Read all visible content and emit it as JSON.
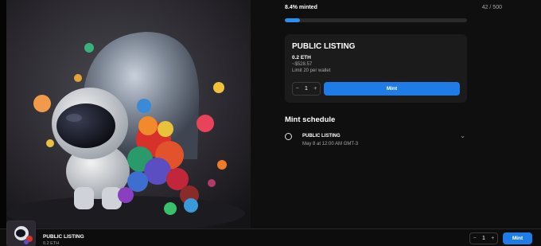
{
  "mint_status": {
    "minted_label": "8.4% minted",
    "supply_label": "42 / 500",
    "minted_fraction": 0.084
  },
  "listing_card": {
    "title": "PUBLIC LISTING",
    "price_eth": "0.2 ETH",
    "price_usd": "~$528.57",
    "limit": "Limit 20 per wallet",
    "quantity": "1",
    "decrement": "−",
    "increment": "+",
    "mint_label": "Mint"
  },
  "schedule": {
    "title": "Mint schedule",
    "items": [
      {
        "name": "PUBLIC LISTING",
        "date": "May 8 at 12:00 AM GMT-3"
      }
    ]
  },
  "bottom_bar": {
    "title": "PUBLIC LISTING",
    "price": "0.2 ETH",
    "quantity": "1",
    "decrement": "−",
    "increment": "+",
    "mint_label": "Mint"
  },
  "icons": {
    "chevron": "chevron-down-icon",
    "radio": "radio-unselected-icon"
  },
  "colors": {
    "accent": "#1f7ce6",
    "progress": "#2b8ff2",
    "card_bg": "#1b1b1b",
    "page_bg": "#0f0f0f"
  }
}
